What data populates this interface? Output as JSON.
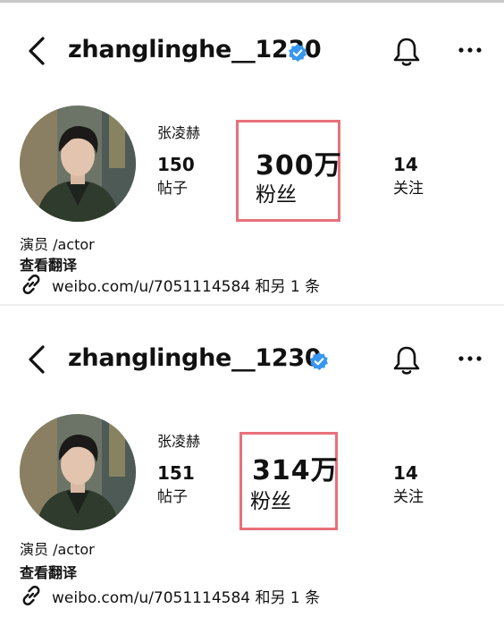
{
  "colors": {
    "verified": "#3797f0",
    "highlight": "#e8707a",
    "text": "#111111"
  },
  "snapshots": [
    {
      "username": "zhanglinghe__1230",
      "display_name": "张凌赫",
      "posts": {
        "count": "150",
        "label": "帖子"
      },
      "followers": {
        "count": "300万",
        "label": "粉丝"
      },
      "following": {
        "count": "14",
        "label": "关注"
      },
      "bio": "演员 /actor",
      "translate": "查看翻译",
      "link": "weibo.com/u/7051114584 和另 1 条"
    },
    {
      "username": "zhanglinghe__1230",
      "display_name": "张凌赫",
      "posts": {
        "count": "151",
        "label": "帖子"
      },
      "followers": {
        "count": "314万",
        "label": "粉丝"
      },
      "following": {
        "count": "14",
        "label": "关注"
      },
      "bio": "演员 /actor",
      "translate": "查看翻译",
      "link": "weibo.com/u/7051114584 和另 1 条"
    }
  ]
}
